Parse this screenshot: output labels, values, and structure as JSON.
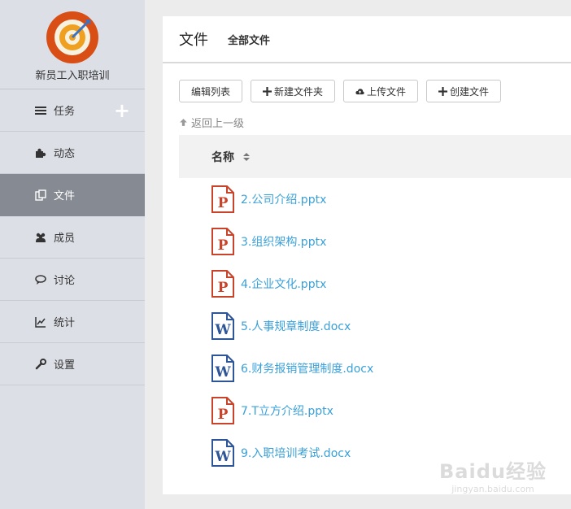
{
  "project": {
    "name": "新员工入职培训"
  },
  "sidebar": {
    "items": [
      {
        "label": "任务",
        "icon": "tasks-icon"
      },
      {
        "label": "动态",
        "icon": "puzzle-icon"
      },
      {
        "label": "文件",
        "icon": "files-icon",
        "active": true
      },
      {
        "label": "成员",
        "icon": "members-icon"
      },
      {
        "label": "讨论",
        "icon": "chat-icon"
      },
      {
        "label": "统计",
        "icon": "chart-icon"
      },
      {
        "label": "设置",
        "icon": "wrench-icon"
      }
    ],
    "add_label": "+"
  },
  "main": {
    "title": "文件",
    "subtitle": "全部文件",
    "toolbar": {
      "edit_list": "编辑列表",
      "new_folder": "新建文件夹",
      "upload": "上传文件",
      "create": "创建文件"
    },
    "back_label": "返回上一级",
    "table": {
      "column_name": "名称"
    },
    "files": [
      {
        "name": "2.公司介绍.pptx",
        "type": "ppt"
      },
      {
        "name": "3.组织架构.pptx",
        "type": "ppt"
      },
      {
        "name": "4.企业文化.pptx",
        "type": "ppt"
      },
      {
        "name": "5.人事规章制度.docx",
        "type": "doc"
      },
      {
        "name": "6.财务报销管理制度.docx",
        "type": "doc"
      },
      {
        "name": "7.T立方介绍.pptx",
        "type": "ppt"
      },
      {
        "name": "9.入职培训考试.docx",
        "type": "doc"
      }
    ]
  },
  "watermark": {
    "main": "Baidu经验",
    "sub": "jingyan.baidu.com"
  },
  "colors": {
    "link": "#3aa0d8",
    "ppt": "#c8432a",
    "doc": "#2e5597",
    "active_nav": "#868a92"
  }
}
